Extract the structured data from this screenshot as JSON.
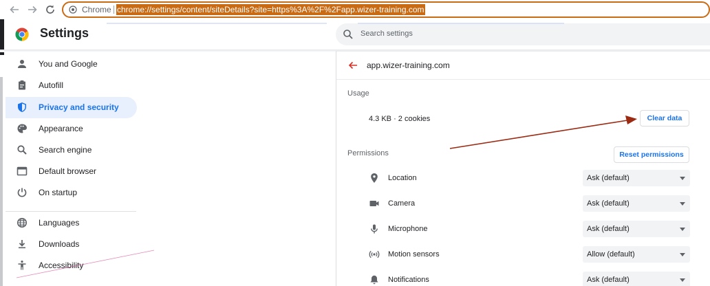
{
  "browser": {
    "omnibox_chip": "Chrome",
    "url": "chrome://settings/content/siteDetails?site=https%3A%2F%2Fapp.wizer-training.com"
  },
  "settings": {
    "title": "Settings",
    "search_placeholder": "Search settings"
  },
  "sidebar": {
    "items": [
      {
        "label": "You and Google",
        "icon": "person-icon",
        "active": false
      },
      {
        "label": "Autofill",
        "icon": "clipboard-icon",
        "active": false
      },
      {
        "label": "Privacy and security",
        "icon": "shield-icon",
        "active": true
      },
      {
        "label": "Appearance",
        "icon": "palette-icon",
        "active": false
      },
      {
        "label": "Search engine",
        "icon": "search-icon",
        "active": false
      },
      {
        "label": "Default browser",
        "icon": "browser-window-icon",
        "active": false
      },
      {
        "label": "On startup",
        "icon": "power-icon",
        "active": false
      },
      {
        "label": "Languages",
        "icon": "globe-icon",
        "active": false
      },
      {
        "label": "Downloads",
        "icon": "download-icon",
        "active": false
      },
      {
        "label": "Accessibility",
        "icon": "accessibility-icon",
        "active": false
      }
    ]
  },
  "site_details": {
    "site": "app.wizer-training.com",
    "usage_label": "Usage",
    "usage_value": "4.3 KB · 2 cookies",
    "clear_data_label": "Clear data",
    "permissions_label": "Permissions",
    "reset_permissions_label": "Reset permissions",
    "permissions": [
      {
        "label": "Location",
        "icon": "location-pin-icon",
        "value": "Ask (default)"
      },
      {
        "label": "Camera",
        "icon": "camera-icon",
        "value": "Ask (default)"
      },
      {
        "label": "Microphone",
        "icon": "microphone-icon",
        "value": "Ask (default)"
      },
      {
        "label": "Motion sensors",
        "icon": "motion-sensors-icon",
        "value": "Allow (default)"
      },
      {
        "label": "Notifications",
        "icon": "bell-icon",
        "value": "Ask (default)"
      }
    ]
  },
  "colors": {
    "accent": "#1a73e8",
    "active_nav_bg": "#e8f0fe",
    "url_highlight": "#c96a14",
    "annotation_arrow": "#9b2a12"
  }
}
